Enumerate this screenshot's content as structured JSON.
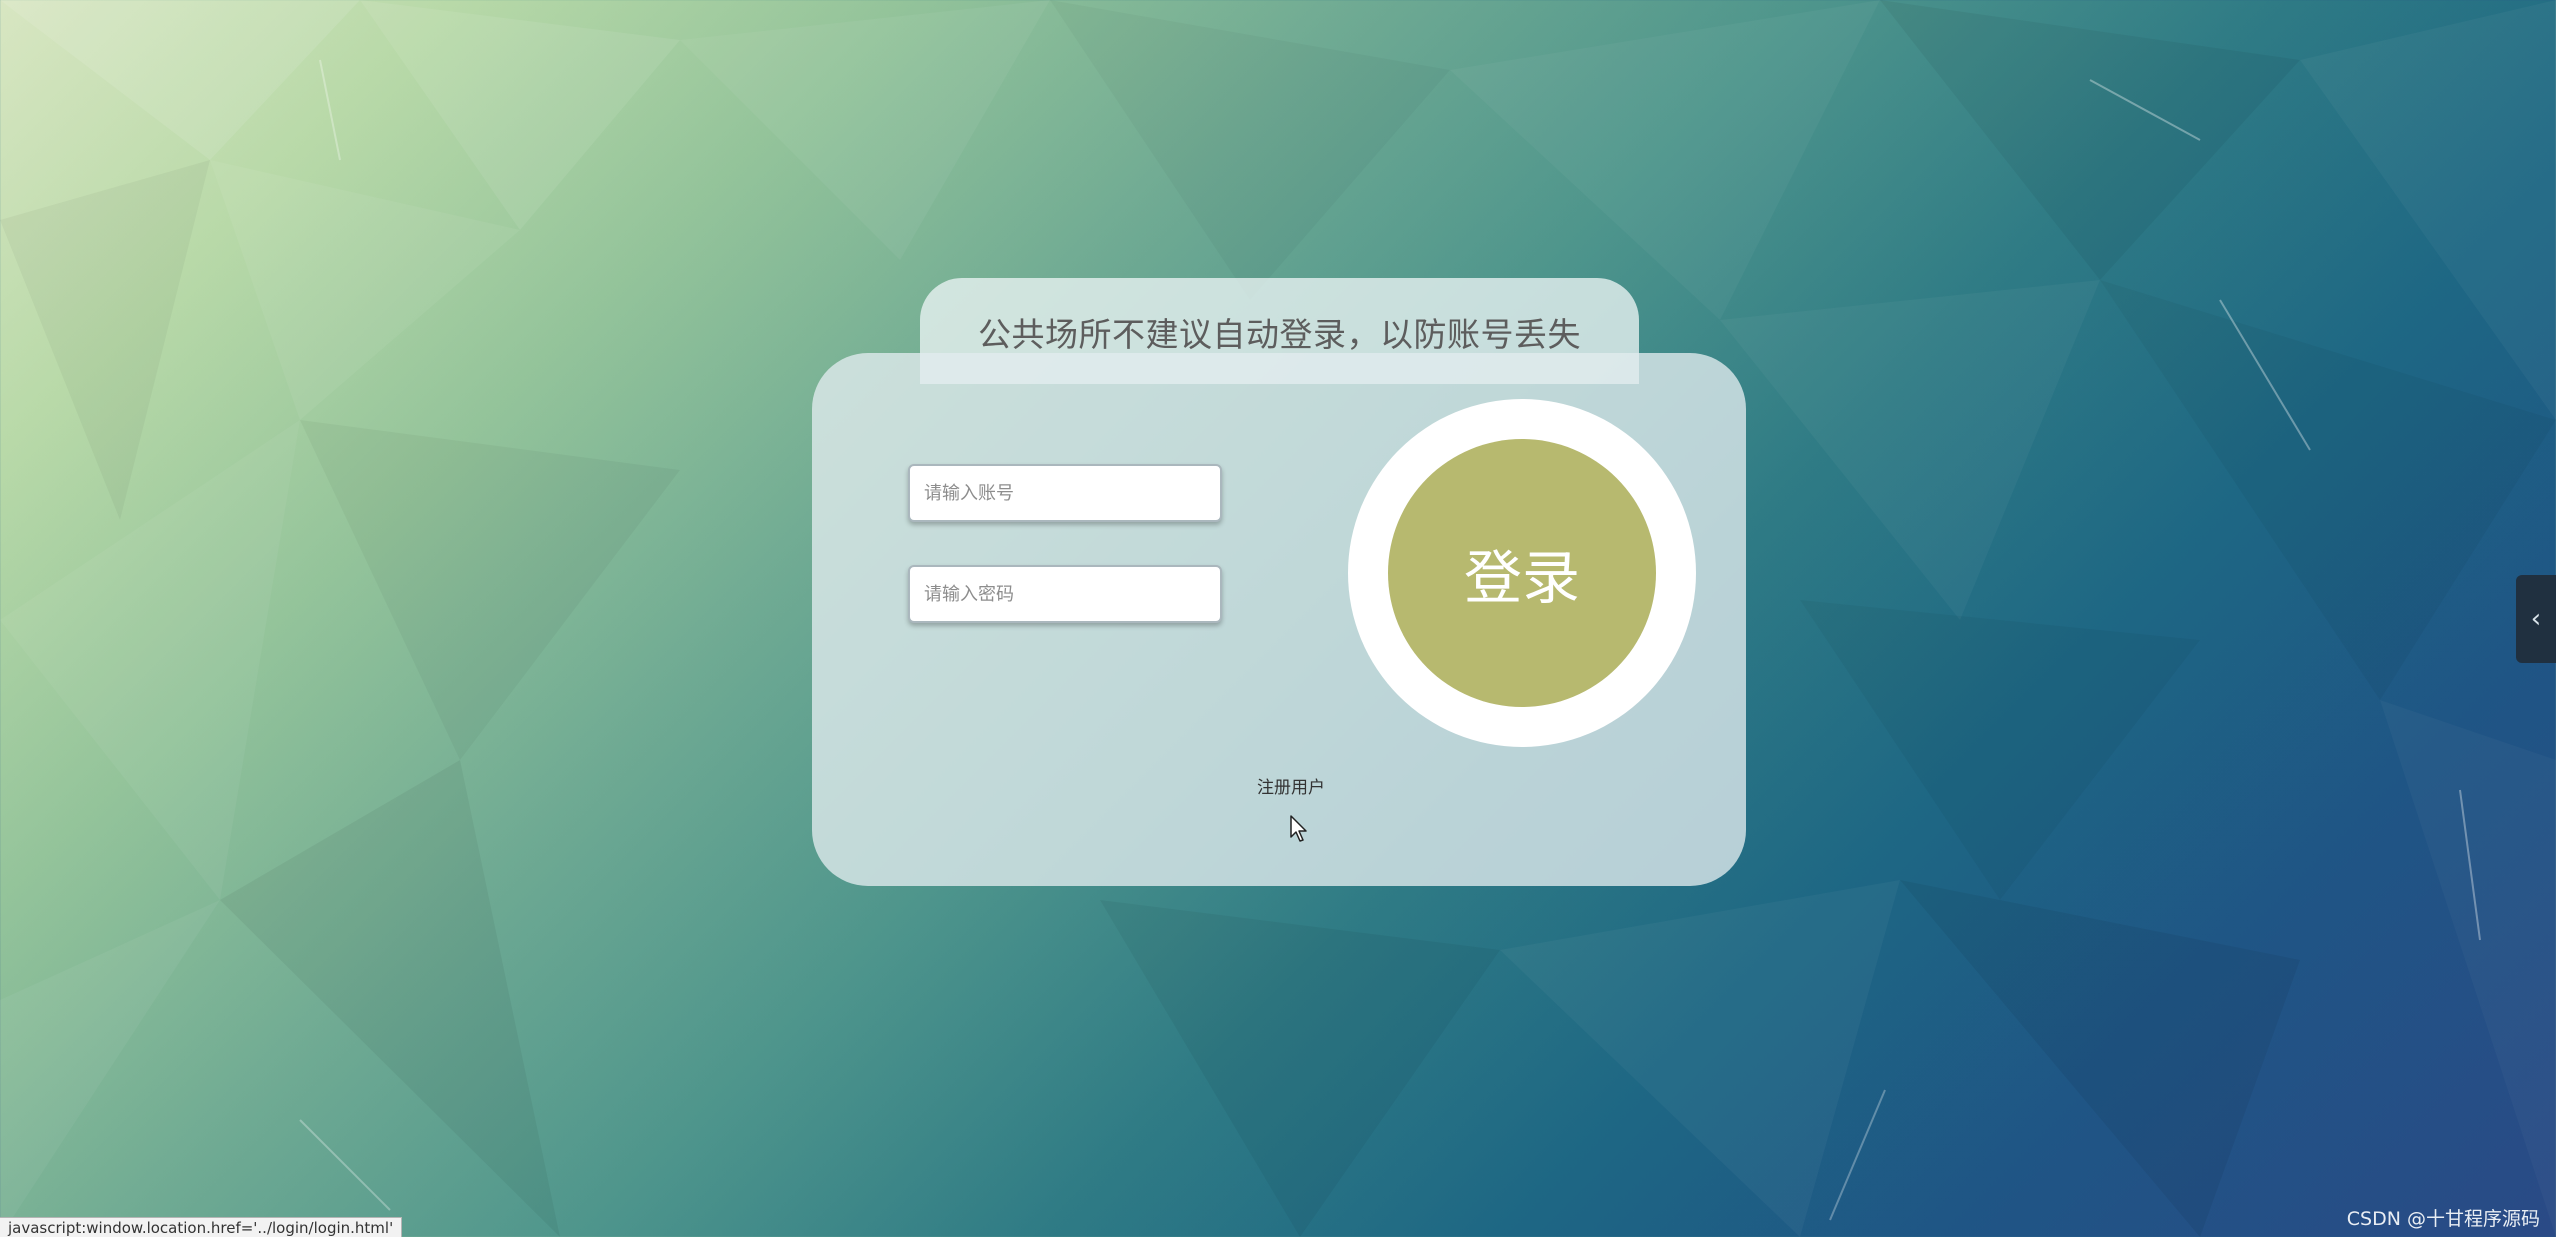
{
  "tip": {
    "text": "公共场所不建议自动登录，以防账号丢失"
  },
  "form": {
    "username_placeholder": "请输入账号",
    "password_placeholder": "请输入密码",
    "login_label": "登录",
    "register_label": "注册用户"
  },
  "status_bar": {
    "text": "javascript:window.location.href='../login/login.html'"
  },
  "watermark": {
    "text": "CSDN @十甘程序源码"
  },
  "side_tab": {
    "icon": "chevron-left-icon"
  },
  "colors": {
    "login_button": "#b7b96f",
    "side_tab": "#203040"
  }
}
